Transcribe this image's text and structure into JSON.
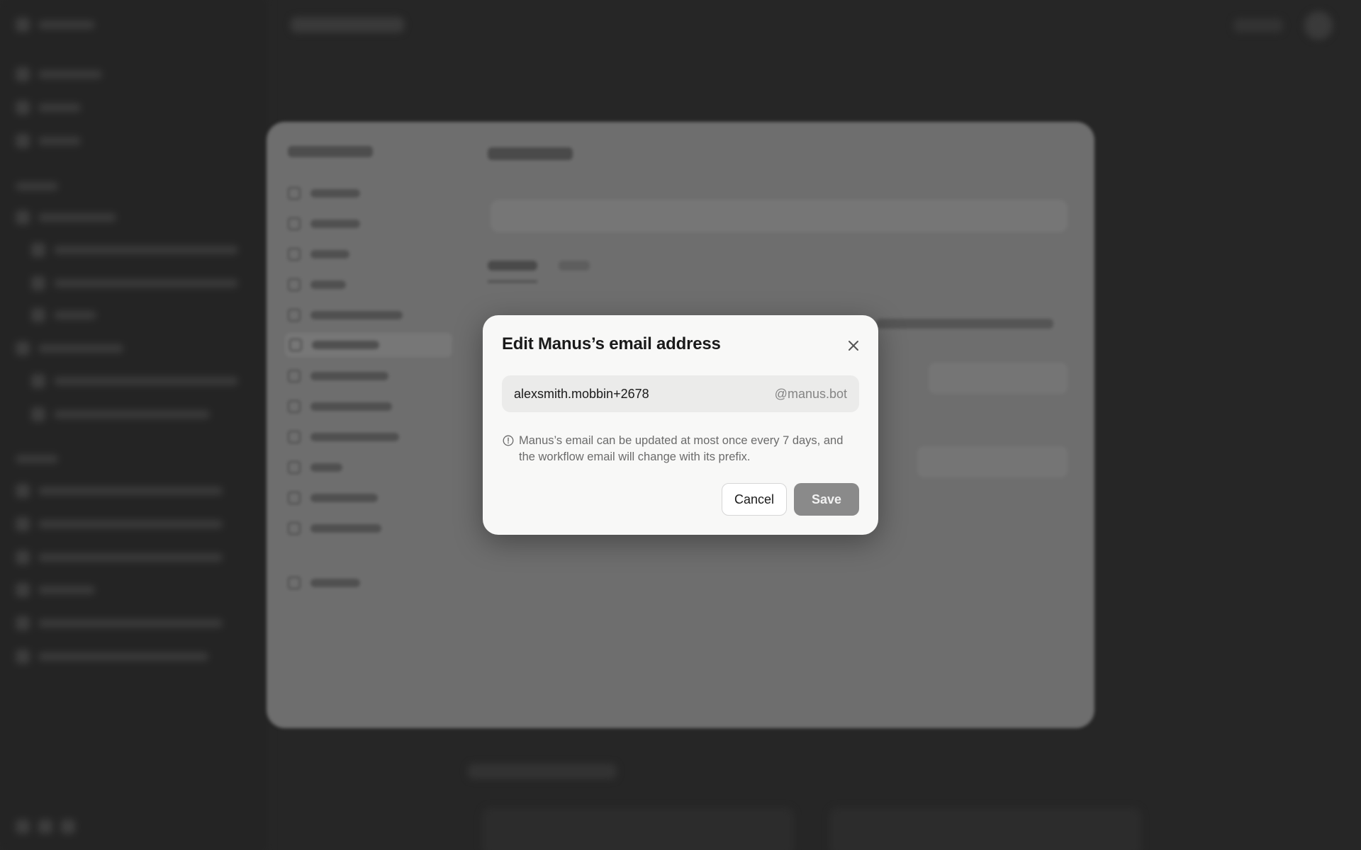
{
  "dialog": {
    "title": "Edit Manus’s email address",
    "email_value": "alexsmith.mobbin+2678",
    "email_domain": "@manus.bot",
    "note": "Manus’s email can be updated at most once every 7 days, and the workflow email will change with its prefix.",
    "cancel_label": "Cancel",
    "save_label": "Save"
  },
  "colors": {
    "dialog_bg": "#f8f8f7",
    "field_bg": "#ebebea",
    "save_disabled": "#8a8a8a",
    "overlay": "#262626"
  },
  "icons": {
    "close": "close-icon",
    "info": "info-icon"
  }
}
